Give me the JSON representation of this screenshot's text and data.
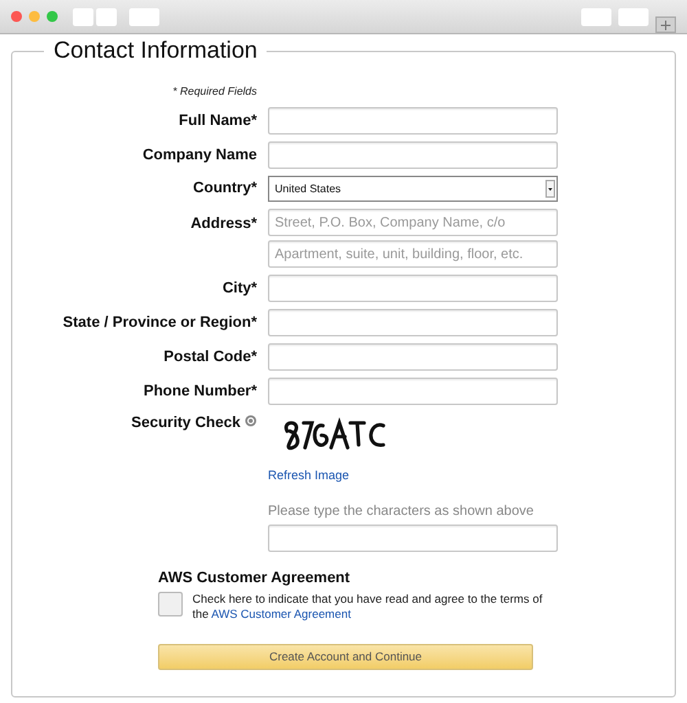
{
  "form": {
    "legend": "Contact Information",
    "required_note": "* Required Fields",
    "fields": [
      {
        "kind": "text",
        "label": "Full Name*"
      },
      {
        "kind": "text",
        "label": "Company Name"
      },
      {
        "kind": "select",
        "label": "Country*",
        "value": "United States"
      },
      {
        "kind": "multi",
        "label": "Address*",
        "placeholders": [
          "Street, P.O. Box, Company Name, c/o",
          "Apartment, suite, unit, building, floor, etc."
        ]
      },
      {
        "kind": "text",
        "label": "City*"
      },
      {
        "kind": "text",
        "label": "State / Province or Region*"
      },
      {
        "kind": "text",
        "label": "Postal Code*"
      },
      {
        "kind": "text",
        "label": "Phone Number*"
      }
    ],
    "security": {
      "label": "Security Check",
      "refresh_link": "Refresh Image",
      "prompt": "Please type the characters as shown above"
    },
    "agreement": {
      "title": "AWS Customer Agreement",
      "text": "Check here to indicate that you have read and agree to the terms of the",
      "link": "AWS Customer Agreement",
      "checked": false
    },
    "submit": "Create Account and Continue"
  }
}
